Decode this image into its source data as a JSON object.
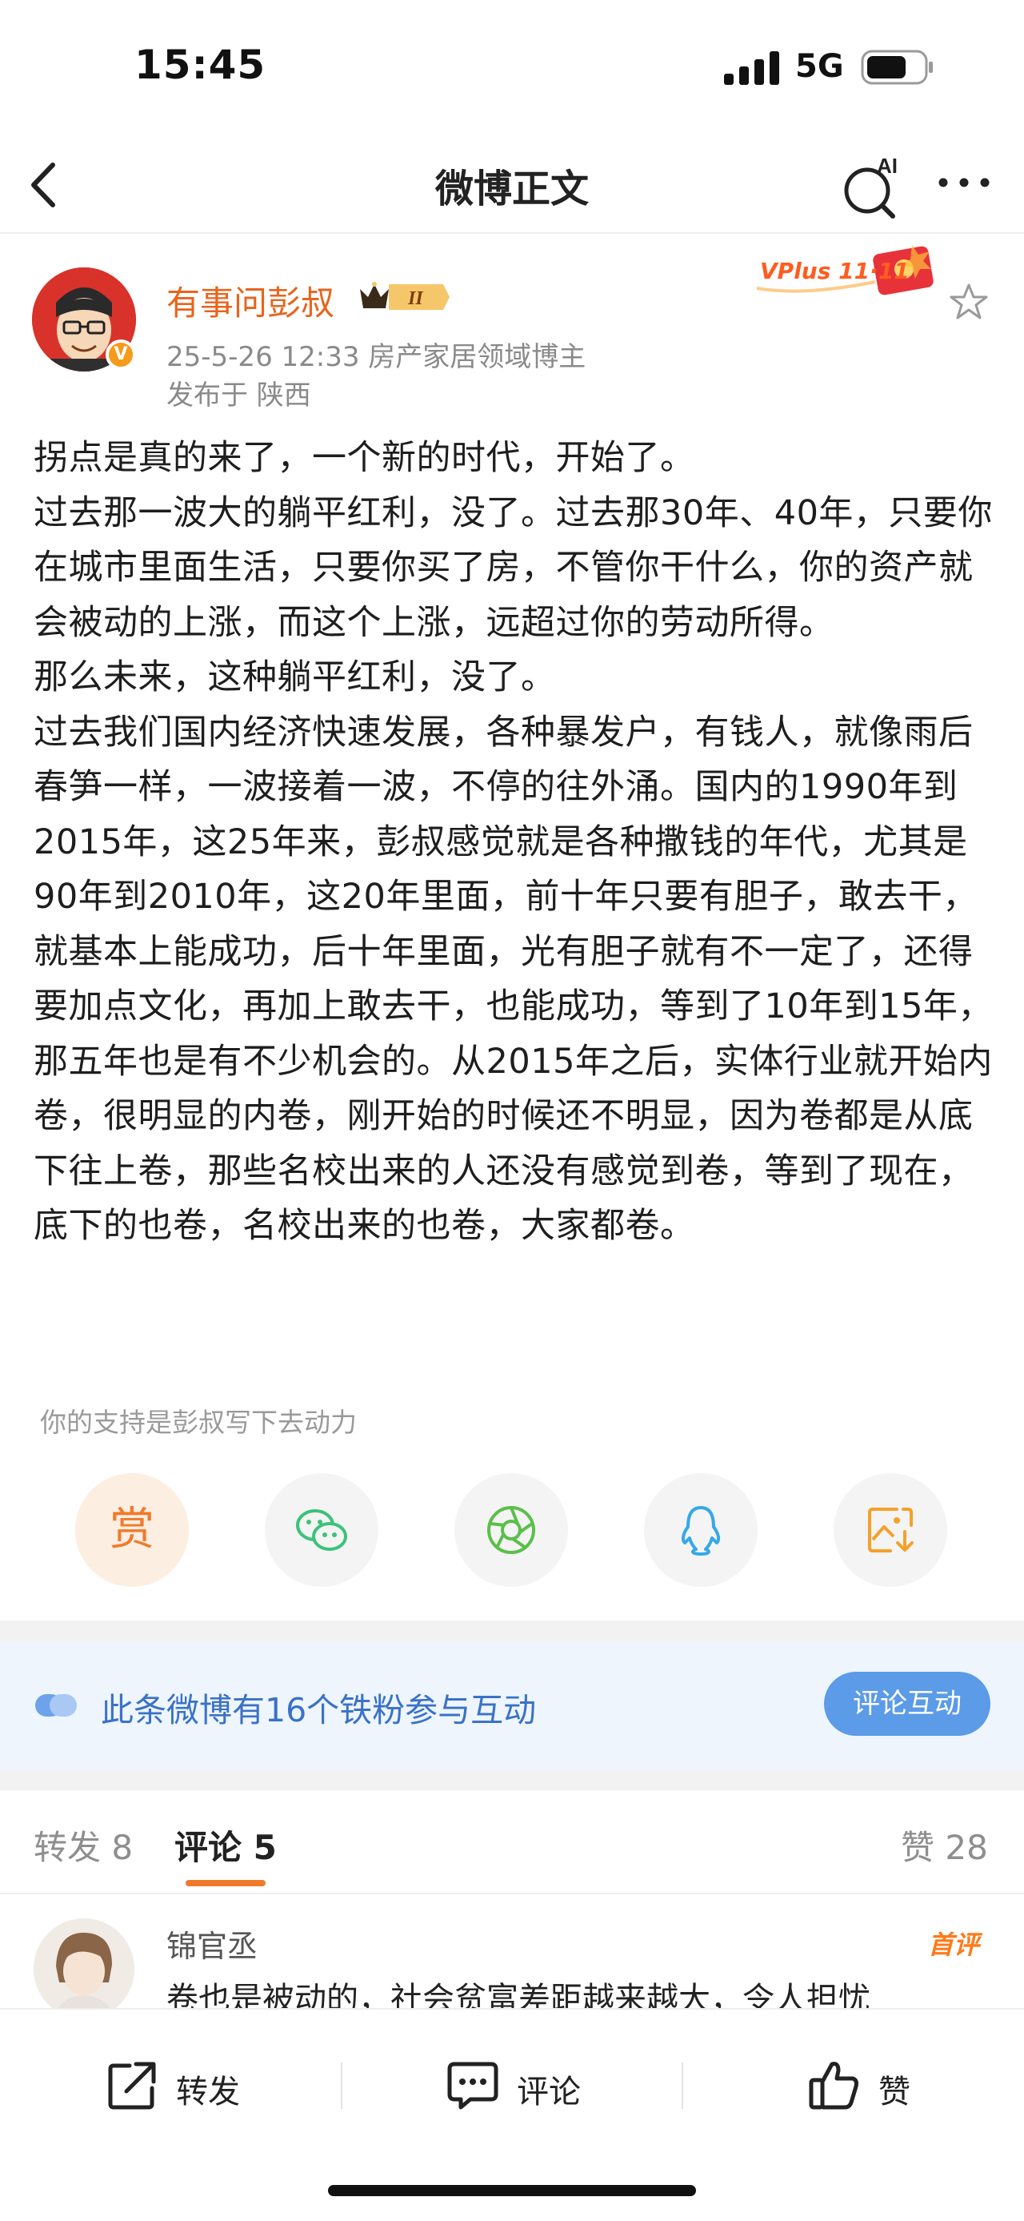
{
  "status": {
    "time": "15:45",
    "network": "5G"
  },
  "header": {
    "title": "微博正文",
    "ai_label": "AI",
    "icons": {
      "back": "back-arrow-icon",
      "search": "ai-search-icon",
      "more": "more-dots-icon"
    }
  },
  "post": {
    "author": "有事问彭叔",
    "level_badge": "II",
    "verified_mark": "V",
    "meta": "25-5-26 12:33  房产家居领域博主",
    "location": "发布于 陕西",
    "promo": "VPlus 11·11",
    "paragraphs": [
      "拐点是真的来了，一个新的时代，开始了。",
      "过去那一波大的躺平红利，没了。过去那30年、40年，只要你在城市里面生活，只要你买了房，不管你干什么，你的资产就会被动的上涨，而这个上涨，远超过你的劳动所得。",
      "那么未来，这种躺平红利，没了。",
      "过去我们国内经济快速发展，各种暴发户，有钱人，就像雨后春笋一样，一波接着一波，不停的往外涌。国内的1990年到2015年，这25年来，彭叔感觉就是各种撒钱的年代，尤其是90年到2010年，这20年里面，前十年只要有胆子，敢去干，就基本上能成功，后十年里面，光有胆子就有不一定了，还得要加点文化，再加上敢去干，也能成功，等到了10年到15年，那五年也是有不少机会的。从2015年之后，实体行业就开始内卷，很明显的内卷，刚开始的时候还不明显，因为卷都是从底下往上卷，那些名校出来的人还没有感觉到卷，等到了现在，底下的也卷，名校出来的也卷，大家都卷。"
    ],
    "support_text": "你的支持是彭叔写下去动力"
  },
  "share": {
    "reward_label": "赏",
    "icons": [
      "reward-icon",
      "wechat-icon",
      "moments-icon",
      "qq-icon",
      "save-image-icon"
    ]
  },
  "fans_banner": {
    "text": "此条微博有16个铁粉参与互动",
    "button": "评论互动"
  },
  "tabs": {
    "repost": "转发 8",
    "comment": "评论 5",
    "like": "赞 28"
  },
  "comment": {
    "name": "锦官丞",
    "badge": "首评",
    "text": "卷也是被动的，社会贫富差距越来越大，令人担忧"
  },
  "bottom": {
    "repost": "转发",
    "comment": "评论",
    "like": "赞"
  },
  "colors": {
    "accent_orange": "#f07a2b",
    "link_blue": "#3a72c6",
    "button_blue": "#5b9be7",
    "avatar_red": "#d9322b"
  }
}
